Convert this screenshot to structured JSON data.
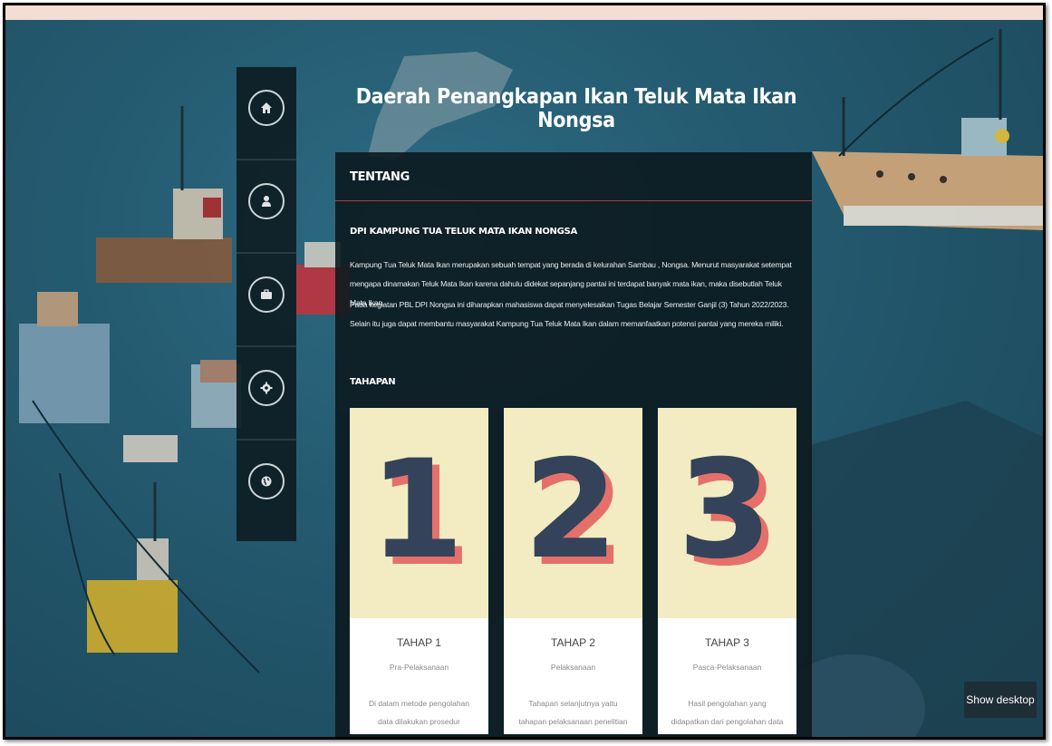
{
  "page": {
    "title": "Daerah Penangkapan Ikan Teluk Mata Ikan Nongsa"
  },
  "sidenav": {
    "items": [
      {
        "icon": "home-icon"
      },
      {
        "icon": "user-icon"
      },
      {
        "icon": "briefcase-icon"
      },
      {
        "icon": "gear-icon"
      },
      {
        "icon": "globe-icon"
      }
    ]
  },
  "panel": {
    "header": "TENTANG",
    "about_title": "DPI KAMPUNG TUA TELUK MATA IKAN NONGSA",
    "paragraph1": "Kampung Tua Teluk Mata Ikan merupakan sebuah tempat yang berada di kelurahan Sambau , Nongsa. Menurut masyarakat setempat mengapa dinamakan Teluk Mata Ikan karena dahulu didekat sepanjang pantai ini terdapat banyak mata ikan, maka disebutlah Teluk Mata Ikan.",
    "paragraph2": "Pada kegiatan PBL DPI Nongsa ini diharapkan mahasiswa dapat menyelesaikan Tugas Belajar Semester Ganjil (3) Tahun 2022/2023. Selain itu juga dapat membantu masyarakat Kampung Tua Teluk Mata Ikan dalam memanfaatkan potensi pantai yang mereka miliki.",
    "stages_title": "TAHAPAN",
    "stages": [
      {
        "number": "1",
        "title": "TAHAP 1",
        "subtitle": "Pra-Pelaksanaan",
        "desc": "Di dalam metode pengolahan data dilakukan prosedur pengolahan dan analisis"
      },
      {
        "number": "2",
        "title": "TAHAP 2",
        "subtitle": "Pelaksanaan",
        "desc": "Tahapan selanjutnya yaitu tahapan pelaksanaan penelitian dimana pada"
      },
      {
        "number": "3",
        "title": "TAHAP 3",
        "subtitle": "Pasca-Pelaksanaan",
        "desc": "Hasil pengolahan yang didapatkan dari pengolahan data primer dan sekunder"
      }
    ]
  },
  "show_desktop": "Show desktop",
  "colors": {
    "number_fill": "#34435a",
    "number_shadow": "#e5706a",
    "card_art_bg": "#f3ecc2",
    "accent_line": "#b33a3a"
  }
}
